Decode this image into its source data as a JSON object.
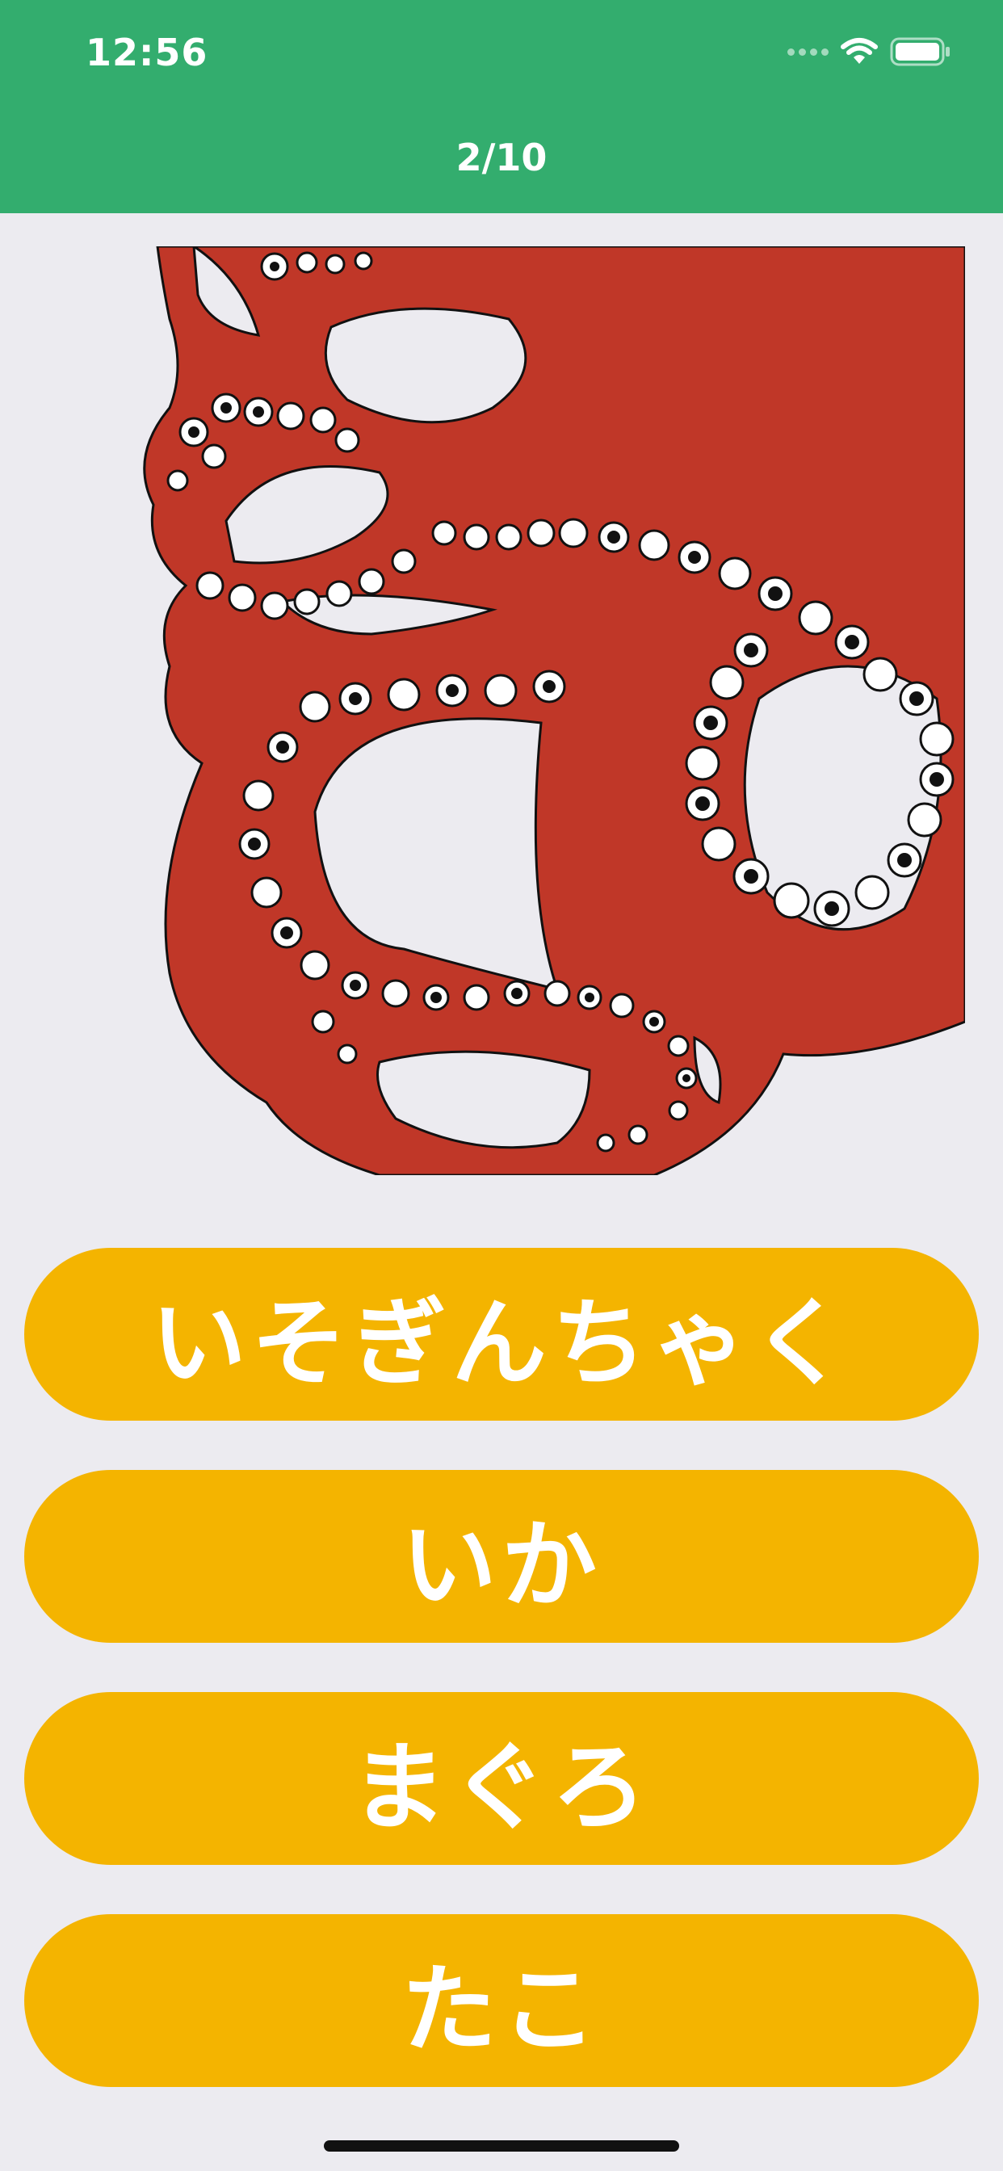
{
  "status_bar": {
    "time": "12:56"
  },
  "nav": {
    "title": "2/10"
  },
  "answers": [
    {
      "label": "いそぎんちゃく"
    },
    {
      "label": "いか"
    },
    {
      "label": "まぐろ"
    },
    {
      "label": "たこ"
    }
  ],
  "colors": {
    "header": "#33ad6e",
    "answer_button": "#f4b400",
    "background": "#ecebf0",
    "octopus": "#c03728"
  }
}
